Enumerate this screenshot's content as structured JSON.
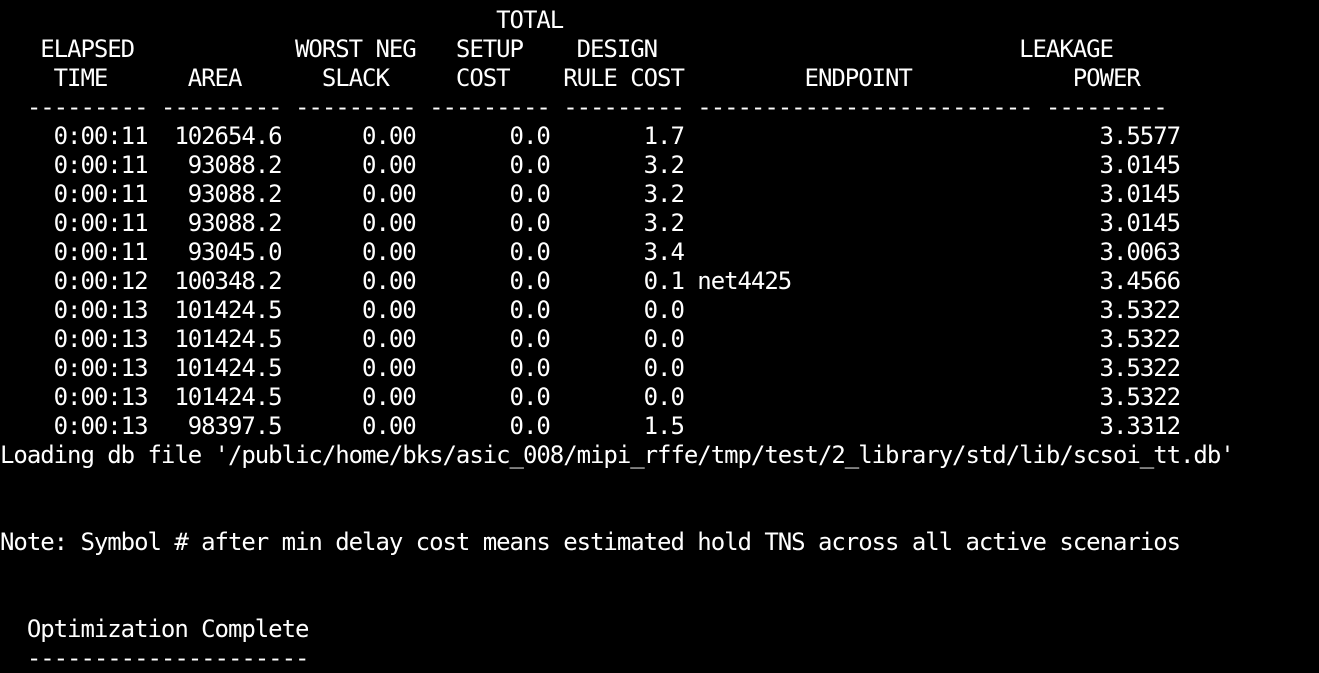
{
  "theme": {
    "background": "#000000",
    "foreground": "#ffffff"
  },
  "report": {
    "header_lines": [
      "                                     TOTAL",
      "   ELAPSED            WORST NEG   SETUP    DESIGN                           LEAKAGE",
      "    TIME      AREA      SLACK     COST    RULE COST         ENDPOINT            POWER",
      "  --------- --------- --------- --------- --------- ------------------------- ---------"
    ],
    "rows": [
      "    0:00:11  102654.6      0.00       0.0       1.7                               3.5577",
      "    0:00:11   93088.2      0.00       0.0       3.2                               3.0145",
      "    0:00:11   93088.2      0.00       0.0       3.2                               3.0145",
      "    0:00:11   93088.2      0.00       0.0       3.2                               3.0145",
      "    0:00:11   93045.0      0.00       0.0       3.4                               3.0063",
      "    0:00:12  100348.2      0.00       0.0       0.1 net4425                       3.4566",
      "    0:00:13  101424.5      0.00       0.0       0.0                               3.5322",
      "    0:00:13  101424.5      0.00       0.0       0.0                               3.5322",
      "    0:00:13  101424.5      0.00       0.0       0.0                               3.5322",
      "    0:00:13  101424.5      0.00       0.0       0.0                               3.5322",
      "    0:00:13   98397.5      0.00       0.0       1.5                               3.3312"
    ]
  },
  "messages": {
    "loading": "Loading db file '/public/home/bks/asic_008/mipi_rffe/tmp/test/2_library/std/lib/scsoi_tt.db'",
    "note": "Note: Symbol # after min delay cost means estimated hold TNS across all active scenarios",
    "complete_title": "  Optimization Complete",
    "complete_rule": "  ---------------------"
  }
}
